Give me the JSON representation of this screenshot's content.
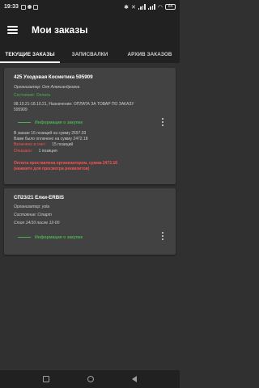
{
  "status_bar": {
    "time": "19:33",
    "battery": "84"
  },
  "app_bar": {
    "title": "Мои заказы"
  },
  "tabs": [
    {
      "label": "ТЕКУЩИЕ ЗАКАЗЫ",
      "active": true
    },
    {
      "label": "ЗАПИСВАЛКИ",
      "active": false
    },
    {
      "label": "АРХИВ ЗАКАЗОВ",
      "active": false
    }
  ],
  "orders": [
    {
      "title": "425 Уходовая Косметика 595909",
      "organizer": "Организатор: Оля Александровна",
      "state": "Состояние: Оплата",
      "dates_note": "08.10.21-18.10.21, Назначение: ОПЛАТА ЗА ТОВАР ПО ЗАКАЗУ",
      "dates_note2": "595909",
      "info_label": "Информация о закупке",
      "in_order": "В заказе 16 позиций на сумму 2597.03",
      "delivered": "Вами было оплачено на сумму 2472.18",
      "included_label": "Включено в счет:",
      "included_value": "15 позиций",
      "refused_label": "Отказано:",
      "refused_value": "1 позиция",
      "payment_note": "Оплата проставлена организатором, сумма 2472.18",
      "payment_note2": "(нажмите для просмотра реквизитов)"
    },
    {
      "title": "СП23/21 Елки-ERBIS",
      "organizer": "Организатор: yola",
      "state": "Состояние: Старт",
      "stop": "Стоп 14/10 после 12-00",
      "info_label": "Информация о закупке"
    }
  ],
  "colors": {
    "accent_green": "#4caf50",
    "accent_red": "#ff5252",
    "background": "#303030",
    "card": "#424242",
    "bar": "#212121"
  }
}
